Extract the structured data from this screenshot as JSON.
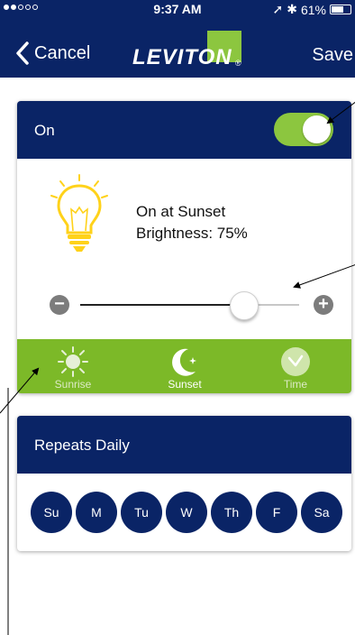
{
  "statusbar": {
    "time": "9:37 AM",
    "battery": "61%"
  },
  "nav": {
    "cancel_label": "Cancel",
    "save_label": "Save",
    "logo_text": "LEVITON"
  },
  "schedule_card": {
    "title": "On",
    "toggle_state": "on",
    "trigger_text": "On at Sunset",
    "brightness_text": "Brightness: 75%",
    "brightness_value": 0.75
  },
  "modes": [
    {
      "label": "Sunrise",
      "icon": "sun-icon",
      "selected": false
    },
    {
      "label": "Sunset",
      "icon": "moon-icon",
      "selected": true
    },
    {
      "label": "Time",
      "icon": "clock-check-icon",
      "selected": false
    }
  ],
  "repeat_card": {
    "title": "Repeats Daily",
    "days": [
      "Su",
      "M",
      "Tu",
      "W",
      "Th",
      "F",
      "Sa"
    ]
  },
  "colors": {
    "navy": "#0a2466",
    "green": "#7cb928",
    "toggle_green": "#8cc63f",
    "bulb_yellow": "#ffd21a"
  }
}
